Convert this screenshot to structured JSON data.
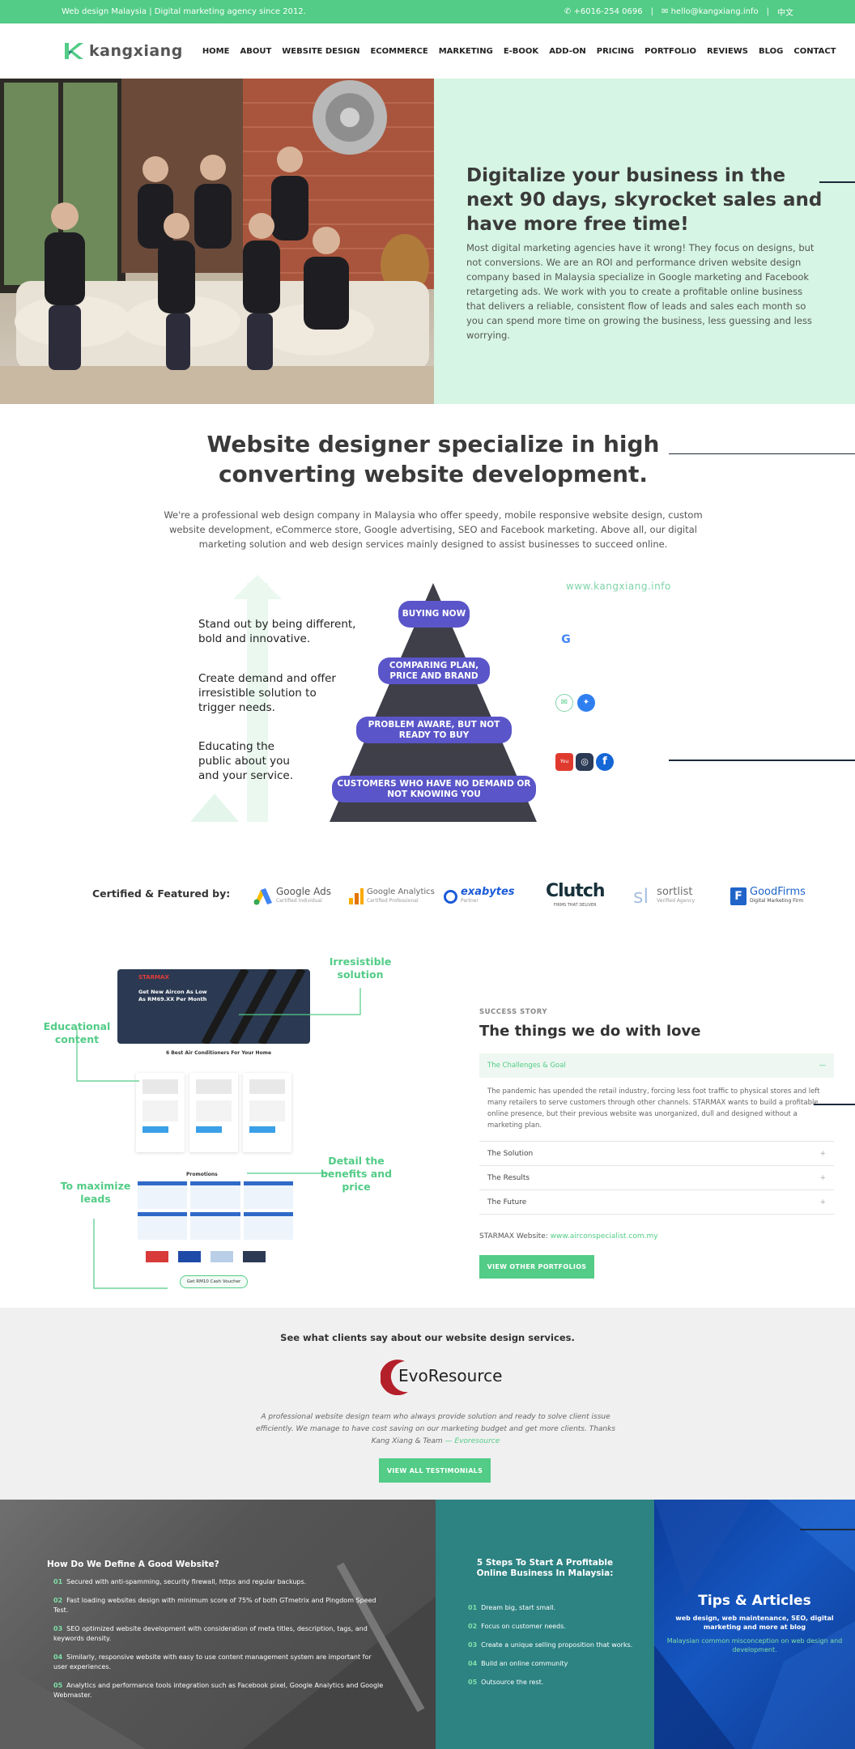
{
  "topbar": {
    "left": "Web design Malaysia | Digital marketing agency since 2012.",
    "phone": "+6016-254 0696",
    "email": "hello@kangxiang.info",
    "lang": "中文",
    "sep": "|"
  },
  "nav": {
    "brand": "kangxiang",
    "items": [
      "HOME",
      "ABOUT",
      "WEBSITE DESIGN",
      "ECOMMERCE",
      "MARKETING",
      "E-BOOK",
      "ADD-ON",
      "PRICING",
      "PORTFOLIO",
      "REVIEWS",
      "BLOG",
      "CONTACT"
    ]
  },
  "hero": {
    "title": "Digitalize your business in the next 90 days, skyrocket sales and have more free time!",
    "text": "Most digital marketing agencies have it wrong! They focus on designs, but not conversions. We are an ROI and performance driven website design company based in Malaysia specialize in Google marketing and Facebook retargeting ads. We work with you to create a profitable online business that delivers a reliable, consistent flow of leads and sales each month so you can spend more time on growing the business, less guessing and less worrying."
  },
  "intro": {
    "title": "Website designer specialize in high converting website development.",
    "text": "We're a professional web design company in Malaysia who offer speedy, mobile responsive website design, custom website development, eCommerce store, Google advertising, SEO and Facebook marketing. Above all, our digital marketing solution and web design services mainly designed to assist businesses to succeed online."
  },
  "funnel": {
    "url": "www.kangxiang.info",
    "labels": [
      "Stand out by being different, bold and innovative.",
      "Create demand and offer irresistible solution to trigger needs.",
      "Educating the public about you and your service."
    ],
    "stages": [
      "BUYING NOW",
      "COMPARING PLAN, PRICE AND BRAND",
      "PROBLEM AWARE, BUT NOT READY TO BUY",
      "CUSTOMERS WHO HAVE NO DEMAND OR NOT KNOWING YOU"
    ],
    "icons": [
      "google-icon",
      "email-icon",
      "messenger-icon",
      "youtube-icon",
      "instagram-icon",
      "facebook-icon"
    ],
    "icon_glyphs": {
      "google": "G",
      "youtube": "You Tube",
      "instagram": "◎",
      "facebook": "f",
      "email": "✉",
      "messenger": "✦"
    }
  },
  "certified": {
    "label": "Certified & Featured by:",
    "logos": [
      {
        "name": "Google Ads",
        "sub": "Certified Individual"
      },
      {
        "name": "Google Analytics",
        "sub": "Certified Professional"
      },
      {
        "name": "exabytes",
        "sub": "Partner"
      },
      {
        "name": "Clutch",
        "sub": "FIRMS THAT DELIVER"
      },
      {
        "name": "sortlist",
        "sub": "Verified Agency",
        "mark": "sl"
      },
      {
        "name": "GoodFirms",
        "sub": "Digital Marketing Firm"
      }
    ]
  },
  "portfolio": {
    "callouts": {
      "irresistible": "Irresistible solution",
      "educational": "Educational content",
      "detail": "Detail the benefits and price",
      "maximize": "To maximize leads"
    },
    "mock": {
      "brand": "STARMAX",
      "headline": "Get New Aircon As Low As RM69.XX Per Month",
      "best": "6 Best Air Conditioners For Your Home",
      "promo": "Promotions",
      "voucher": "Get RM10 Cash Voucher"
    },
    "success": "SUCCESS STORY",
    "title": "The things we do with love",
    "accordion": [
      {
        "label": "The Challenges & Goal",
        "body": "The pandemic has upended the retail industry, forcing less foot traffic to physical stores and left many retailers to serve customers through other channels. STARMAX wants to build a profitable online presence, but their previous website was unorganized, dull and designed without a marketing plan."
      },
      {
        "label": "The Solution"
      },
      {
        "label": "The Results"
      },
      {
        "label": "The Future"
      }
    ],
    "site_label": "STARMAX Website:",
    "site_url": "www.airconspecialist.com.my",
    "button": "VIEW OTHER PORTFOLIOS"
  },
  "testimonial": {
    "heading": "See what clients say about our website design services.",
    "client": "EvoResource",
    "quote": "A professional website design team who always provide solution and ready to solve client issue efficiently. We manage to have cost saving on our marketing budget and get more clients. Thanks Kang Xiang & Team",
    "author": "— Evoresource",
    "button": "VIEW ALL TESTIMONIALS"
  },
  "good_website": {
    "title": "How Do We Define A Good Website?",
    "items": [
      {
        "n": "01",
        "t": "Secured with anti-spamming, security firewall, https and regular backups."
      },
      {
        "n": "02",
        "t": "Fast loading websites design with minimum score of 75% of both GTmetrix and Pingdom Speed Test."
      },
      {
        "n": "03",
        "t": "SEO optimized website development with consideration of meta titles, description, tags, and keywords density."
      },
      {
        "n": "04",
        "t": "Similarly, responsive website with easy to use content management system are important for user experiences."
      },
      {
        "n": "05",
        "t": "Analytics and performance tools integration such as Facebook pixel, Google Analytics and Google Webmaster."
      }
    ]
  },
  "steps": {
    "title": "5 Steps To Start A Profitable Online Business In Malaysia:",
    "items": [
      {
        "n": "01",
        "t": "Dream big, start small."
      },
      {
        "n": "02",
        "t": "Focus on customer needs."
      },
      {
        "n": "03",
        "t": "Create a unique selling proposition that works."
      },
      {
        "n": "04",
        "t": "Build an online community"
      },
      {
        "n": "05",
        "t": "Outsource the rest."
      }
    ]
  },
  "tips": {
    "title": "Tips & Articles",
    "sub": "web design, web maintenance, SEO, digital marketing and more at blog",
    "text": "Malaysian common misconception on web design and development."
  },
  "colors": {
    "accent": "#52cc86",
    "hero_bg": "#d6f5e4",
    "funnel_pill": "#5a55c8",
    "teal": "#2d8282",
    "blue": "#1556c0"
  }
}
